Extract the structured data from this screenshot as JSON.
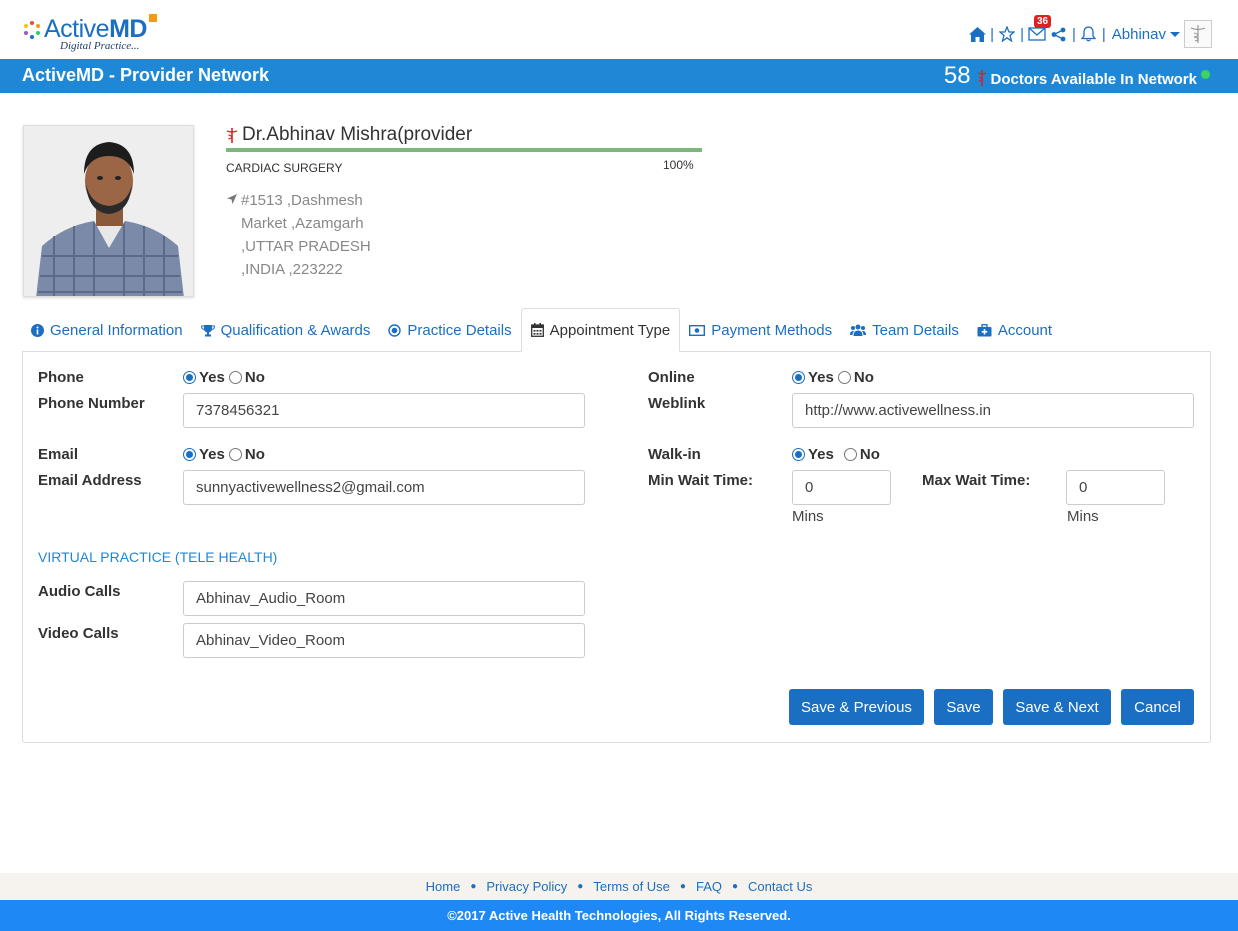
{
  "brand": {
    "logo_main": "Active",
    "logo_bold": "MD",
    "logo_sub": "Digital Practice...",
    "colors": {
      "primary": "#1a6fc3",
      "bar": "#1e88d6",
      "accent": "#f39a1b",
      "badge": "#e02020",
      "online": "#3ed35f"
    }
  },
  "header": {
    "icons": [
      "home-icon",
      "star-icon",
      "mail-icon",
      "share-icon",
      "bell-icon"
    ],
    "mail_badge": "36",
    "user_name": "Abhinav"
  },
  "bar": {
    "title": "ActiveMD - Provider Network",
    "network_count": "58",
    "network_label": "Doctors Available In Network"
  },
  "profile": {
    "name": "Dr.Abhinav Mishra(provider",
    "specialty": "CARDIAC SURGERY",
    "completion": "100%",
    "completion_fraction": 1.0,
    "address": [
      "#1513 ,Dashmesh",
      "Market ,Azamgarh",
      ",UTTAR PRADESH",
      ",INDIA ,223222"
    ]
  },
  "tabs": [
    {
      "label": "General Information",
      "icon": "info-icon"
    },
    {
      "label": "Qualification & Awards",
      "icon": "trophy-icon"
    },
    {
      "label": "Practice Details",
      "icon": "target-icon"
    },
    {
      "label": "Appointment Type",
      "icon": "calendar-icon",
      "active": true
    },
    {
      "label": "Payment Methods",
      "icon": "money-icon"
    },
    {
      "label": "Team Details",
      "icon": "users-icon"
    },
    {
      "label": "Account",
      "icon": "medkit-icon"
    }
  ],
  "form": {
    "phone_label": "Phone",
    "phone_number_label": "Phone Number",
    "phone_number": "7378456321",
    "email_label": "Email",
    "email_address_label": "Email Address",
    "email_address": "sunnyactivewellness2@gmail.com",
    "online_label": "Online",
    "weblink_label": "Weblink",
    "weblink": "http://www.activewellness.in",
    "walkin_label": "Walk-in",
    "min_wait_label": "Min Wait Time:",
    "min_wait": "0",
    "max_wait_label": "Max Wait Time:",
    "max_wait": "0",
    "mins": "Mins",
    "yes": "Yes",
    "no": "No",
    "virtual_title": "VIRTUAL PRACTICE (TELE HEALTH)",
    "audio_label": "Audio Calls",
    "audio_value": "Abhinav_Audio_Room",
    "video_label": "Video Calls",
    "video_value": "Abhinav_Video_Room"
  },
  "buttons": {
    "save_previous": "Save & Previous",
    "save": "Save",
    "save_next": "Save & Next",
    "cancel": "Cancel"
  },
  "footer": {
    "links": [
      "Home",
      "Privacy Policy",
      "Terms of Use",
      "FAQ",
      "Contact Us"
    ],
    "copyright": "©2017 Active Health Technologies, All Rights Reserved."
  }
}
